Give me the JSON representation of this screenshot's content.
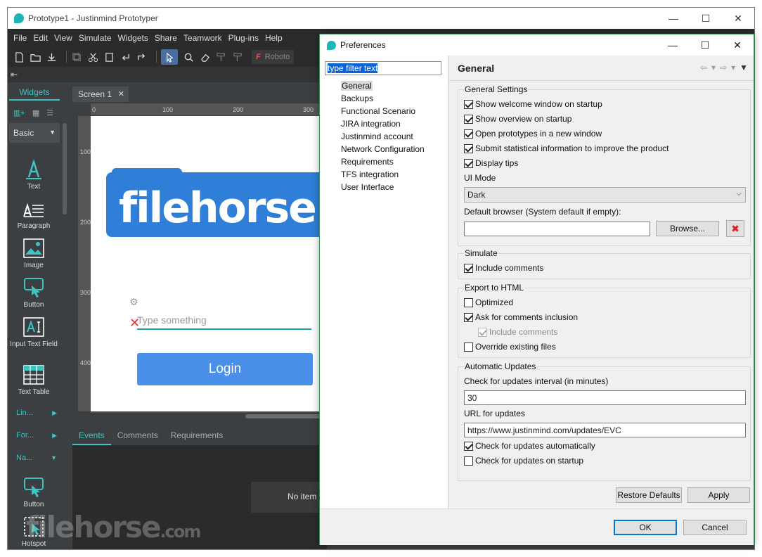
{
  "app": {
    "title": "Prototype1 - Justinmind Prototyper",
    "window_controls": [
      "—",
      "☐",
      "✕"
    ],
    "menu": [
      "File",
      "Edit",
      "View",
      "Simulate",
      "Widgets",
      "Share",
      "Teamwork",
      "Plug-ins",
      "Help"
    ],
    "font_box": "Roboto",
    "font_icon": "F"
  },
  "widgets_panel": {
    "tab": "Widgets",
    "library": "Basic",
    "items": [
      {
        "label": "Text",
        "icon": "text-icon"
      },
      {
        "label": "Paragraph",
        "icon": "paragraph-icon"
      },
      {
        "label": "Image",
        "icon": "image-icon"
      },
      {
        "label": "Button",
        "icon": "button-icon"
      },
      {
        "label": "Input Text Field",
        "icon": "input-text-field-icon"
      },
      {
        "label": "Text Table",
        "icon": "table-icon"
      }
    ],
    "categories": [
      "Lin...",
      "For...",
      "Na..."
    ],
    "extra_items": [
      {
        "label": "Button",
        "icon": "button-icon"
      },
      {
        "label": "Hotspot",
        "icon": "hotspot-icon"
      }
    ]
  },
  "canvas": {
    "tab": "Screen 1",
    "ruler_h": [
      "0",
      "100",
      "200",
      "300"
    ],
    "ruler_v": [
      "100",
      "200",
      "300",
      "400"
    ],
    "logo_text": "filehorse",
    "input_placeholder": "Type something",
    "login_label": "Login"
  },
  "bottom_panel": {
    "tabs": [
      "Events",
      "Comments",
      "Requirements"
    ],
    "empty_text": "No item"
  },
  "watermark": {
    "main": "filehorse",
    "suffix": ".com"
  },
  "preferences": {
    "title": "Preferences",
    "window_controls": [
      "—",
      "☐",
      "✕"
    ],
    "filter_placeholder": "type filter text",
    "nav": [
      "General",
      "Backups",
      "Functional Scenario",
      "JIRA integration",
      "Justinmind account",
      "Network Configuration",
      "Requirements",
      "TFS integration",
      "User Interface"
    ],
    "selected_nav": "General",
    "page_title": "General",
    "general_settings": {
      "title": "General Settings",
      "options": [
        {
          "label": "Show welcome window on startup",
          "checked": true
        },
        {
          "label": "Show overview on startup",
          "checked": true
        },
        {
          "label": "Open prototypes in a new window",
          "checked": true
        },
        {
          "label": "Submit statistical information to improve the product",
          "checked": true
        },
        {
          "label": "Display tips",
          "checked": true
        }
      ],
      "ui_mode_label": "UI Mode",
      "ui_mode_value": "Dark",
      "browser_label": "Default browser (System default if empty):",
      "browser_value": "",
      "browse_label": "Browse..."
    },
    "simulate": {
      "title": "Simulate",
      "include_comments": {
        "label": "Include comments",
        "checked": true
      }
    },
    "export_html": {
      "title": "Export to HTML",
      "optimized": {
        "label": "Optimized",
        "checked": false
      },
      "ask_comments": {
        "label": "Ask for comments inclusion",
        "checked": true
      },
      "include_comments": {
        "label": "Include comments",
        "checked": true,
        "disabled": true
      },
      "override": {
        "label": "Override existing files",
        "checked": false
      }
    },
    "updates": {
      "title": "Automatic Updates",
      "interval_label": "Check for updates interval (in minutes)",
      "interval_value": "30",
      "url_label": "URL for updates",
      "url_value": "https://www.justinmind.com/updates/EVC",
      "auto": {
        "label": "Check for updates automatically",
        "checked": true
      },
      "startup": {
        "label": "Check for updates on startup",
        "checked": false
      }
    },
    "restore_label": "Restore Defaults",
    "apply_label": "Apply",
    "ok_label": "OK",
    "cancel_label": "Cancel"
  },
  "colors": {
    "accent": "#1cb5b5",
    "login_button": "#4a90e8",
    "logo_blue": "#2f7fd8",
    "dialog_border": "#3e8f5a"
  }
}
